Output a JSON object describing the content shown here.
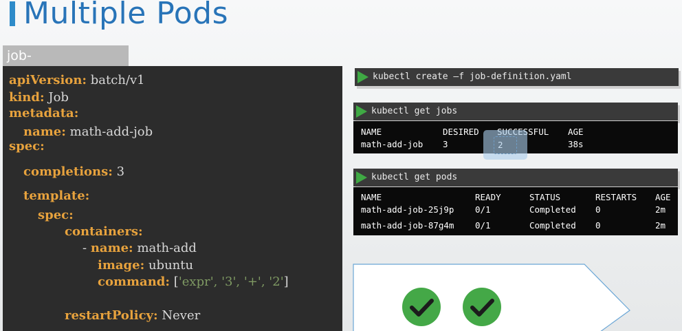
{
  "title": "Multiple Pods",
  "file_tab": "job-definition.yaml",
  "yaml": {
    "apiVersion_key": "apiVersion:",
    "apiVersion_val": "batch/v1",
    "kind_key": "kind:",
    "kind_val": "Job",
    "metadata_key": "metadata:",
    "name_key": "name:",
    "name_val": "math-add-job",
    "spec_key": "spec:",
    "completions_key": "completions:",
    "completions_val": "3",
    "template_key": "template:",
    "spec2_key": "spec:",
    "containers_key": "containers:",
    "dash": "- ",
    "cname_key": "name:",
    "cname_val": "math-add",
    "image_key": "image:",
    "image_val": "ubuntu",
    "command_key": "command:",
    "command_open": "[",
    "command_args": "'expr', '3', '+', '2'",
    "command_close": "]",
    "restart_key": "restartPolicy:",
    "restart_val": "Never"
  },
  "cmd_create": "kubectl create –f job-definition.yaml",
  "cmd_get_jobs": "kubectl get jobs",
  "jobs_table": {
    "headers": [
      "NAME",
      "DESIRED",
      "SUCCESSFUL",
      "AGE"
    ],
    "rows": [
      [
        "math-add-job",
        "3",
        "2",
        "38s"
      ]
    ]
  },
  "cmd_get_pods": "kubectl get pods",
  "pods_table": {
    "headers": [
      "NAME",
      "READY",
      "STATUS",
      "RESTARTS",
      "AGE"
    ],
    "rows": [
      [
        "math-add-job-25j9p",
        "0/1",
        "Completed",
        "0",
        "2m"
      ],
      [
        "math-add-job-87g4m",
        "0/1",
        "Completed",
        "0",
        "2m"
      ]
    ]
  },
  "completed_pods": 2,
  "colors": {
    "title": "#2874b8",
    "yaml_key": "#e7a23d",
    "yaml_string": "#7f9a63",
    "check": "#44a847",
    "play": "#3fa944"
  }
}
